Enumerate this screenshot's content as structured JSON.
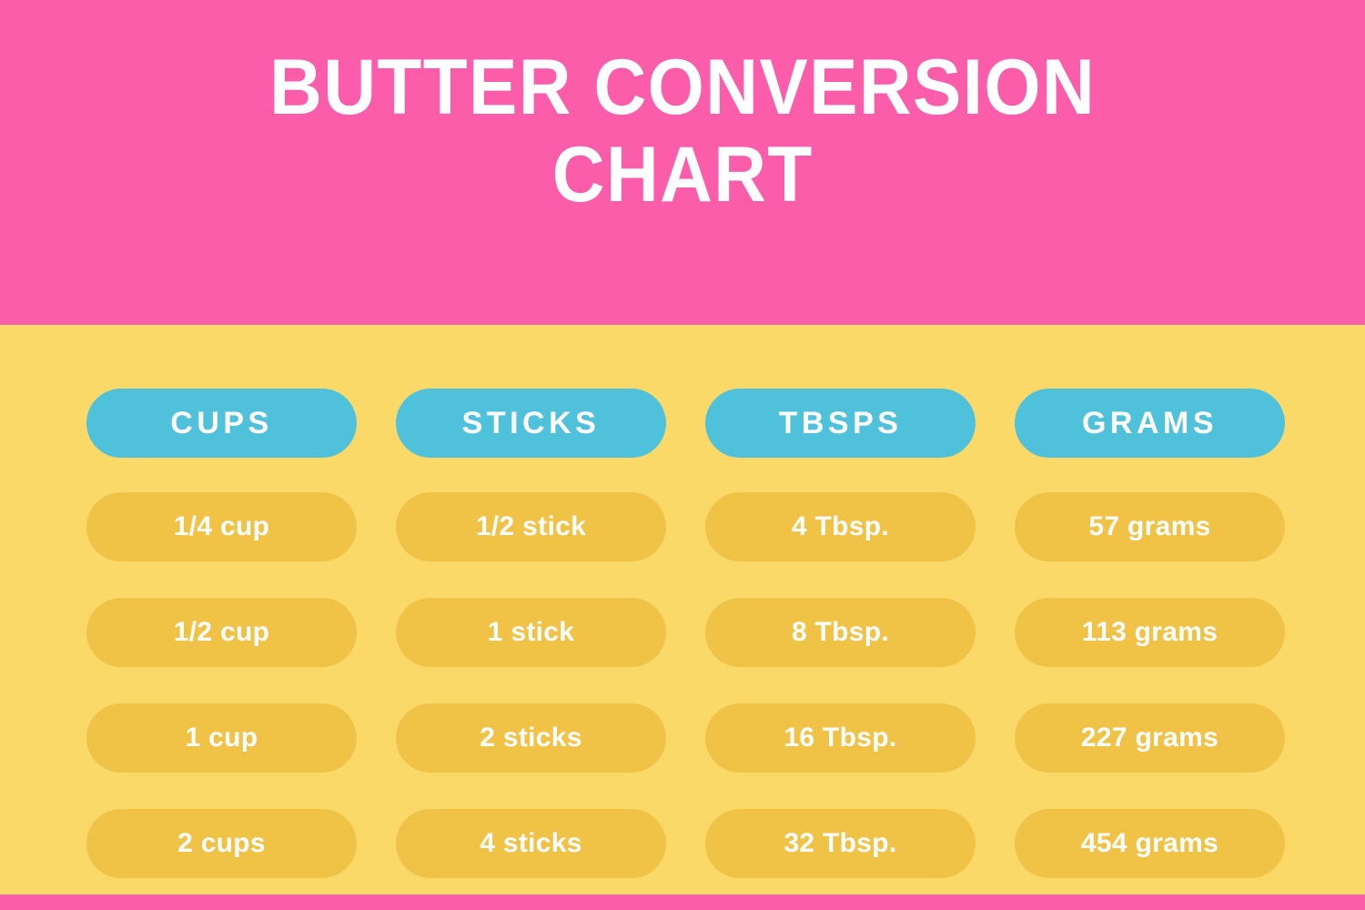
{
  "colors": {
    "pink": "#fb5dab",
    "yellow": "#fbd969",
    "gold": "#f0c246",
    "cyan": "#4fc1db",
    "white": "#ffffff"
  },
  "header": {
    "title_line1": "BUTTER CONVERSION",
    "title_line2": "CHART"
  },
  "chart_data": {
    "type": "table",
    "title": "BUTTER CONVERSION CHART",
    "xlabel": "",
    "ylabel": "",
    "columns": [
      "CUPS",
      "STICKS",
      "TBSPS",
      "GRAMS"
    ],
    "rows": [
      [
        "1/4 cup",
        "1/2 stick",
        "4 Tbsp.",
        "57 grams"
      ],
      [
        "1/2 cup",
        "1 stick",
        "8 Tbsp.",
        "113 grams"
      ],
      [
        "1 cup",
        "2 sticks",
        "16 Tbsp.",
        "227 grams"
      ],
      [
        "2 cups",
        "4 sticks",
        "32 Tbsp.",
        "454 grams"
      ]
    ],
    "numeric": {
      "cups": [
        0.25,
        0.5,
        1,
        2
      ],
      "sticks": [
        0.5,
        1,
        2,
        4
      ],
      "tbsps": [
        4,
        8,
        16,
        32
      ],
      "grams": [
        57,
        113,
        227,
        454
      ]
    },
    "legend": [],
    "grid": false
  },
  "table": {
    "headers": [
      {
        "label": "CUPS"
      },
      {
        "label": "STICKS"
      },
      {
        "label": "TBSPS"
      },
      {
        "label": "GRAMS"
      }
    ],
    "rows": [
      {
        "cups": "1/4 cup",
        "sticks": "1/2 stick",
        "tbsps": "4 Tbsp.",
        "grams": "57 grams"
      },
      {
        "cups": "1/2 cup",
        "sticks": "1 stick",
        "tbsps": "8 Tbsp.",
        "grams": "113 grams"
      },
      {
        "cups": "1 cup",
        "sticks": "2 sticks",
        "tbsps": "16 Tbsp.",
        "grams": "227 grams"
      },
      {
        "cups": "2 cups",
        "sticks": "4 sticks",
        "tbsps": "32 Tbsp.",
        "grams": "454 grams"
      }
    ]
  }
}
